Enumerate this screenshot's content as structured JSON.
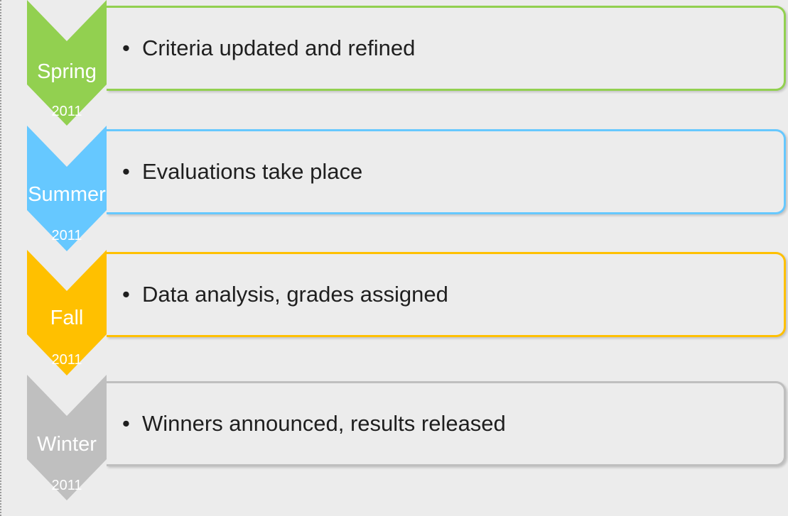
{
  "stages": [
    {
      "season": "Spring",
      "year": "2011",
      "text": "Criteria updated and refined",
      "color": "#92d050"
    },
    {
      "season": "Summer",
      "year": "2011",
      "text": "Evaluations take place",
      "color": "#66c8ff"
    },
    {
      "season": "Fall",
      "year": "2011",
      "text": "Data analysis, grades assigned",
      "color": "#ffc000"
    },
    {
      "season": "Winter",
      "year": "2011",
      "text": "Winners announced, results released",
      "color": "#bfbfbf"
    }
  ],
  "bullet": "•"
}
